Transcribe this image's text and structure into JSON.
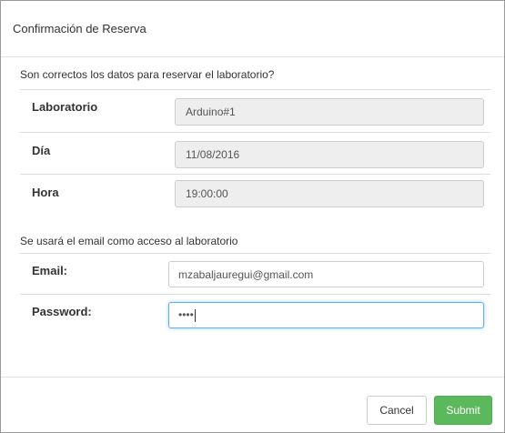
{
  "modal": {
    "title": "Confirmación de Reserva"
  },
  "confirm_section": {
    "question": "Son correctos los datos para reservar el laboratorio?",
    "rows": [
      {
        "label": "Laboratorio",
        "value": "Arduino#1"
      },
      {
        "label": "Día",
        "value": "11/08/2016"
      },
      {
        "label": "Hora",
        "value": "19:00:00"
      }
    ]
  },
  "access_section": {
    "note": "Se usará el email como acceso al laboratorio",
    "email": {
      "label": "Email:",
      "value": "mzabaljauregui@gmail.com"
    },
    "password": {
      "label": "Password:",
      "masked_value": "••••"
    }
  },
  "footer": {
    "cancel_label": "Cancel",
    "submit_label": "Submit"
  },
  "colors": {
    "submit_bg": "#5cb85c",
    "focus_border": "#66afe9",
    "readonly_bg": "#eeeeee"
  }
}
